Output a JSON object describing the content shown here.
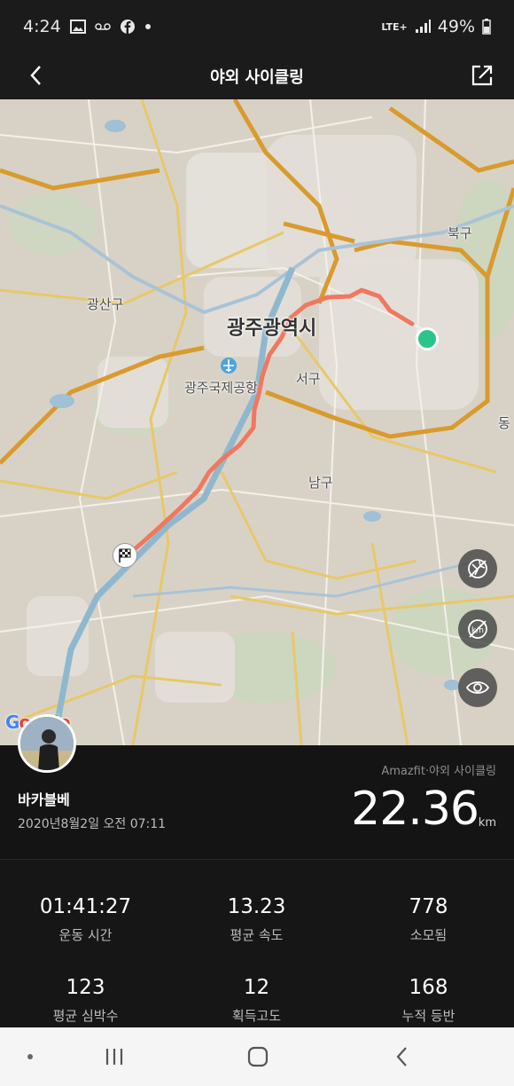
{
  "status_bar": {
    "time": "4:24",
    "network": "LTE+",
    "battery": "49%"
  },
  "header": {
    "title": "야외 사이클링",
    "back_icon": "chevron-left-icon",
    "share_icon": "share-icon"
  },
  "map": {
    "labels": {
      "city": "광주광역시",
      "gwangsan": "광산구",
      "airport": "광주국제공항",
      "seo": "서구",
      "nam": "남구",
      "buk": "북구",
      "dong": "동"
    },
    "controls": [
      "no-satellite-icon",
      "no-kmh-icon",
      "eye-icon"
    ],
    "route_color": "#f07860",
    "start_color": "#2bc48a",
    "attribution": "Google"
  },
  "summary": {
    "username": "바카블베",
    "datetime": "2020년8월2일 오전 07:11",
    "device": "Amazfit·야외 사이클링",
    "distance": "22.36",
    "unit": "km"
  },
  "stats": [
    {
      "value": "01:41:27",
      "label": "운동 시간"
    },
    {
      "value": "13.23",
      "label": "평균 속도"
    },
    {
      "value": "778",
      "label": "소모됨"
    },
    {
      "value": "123",
      "label": "평균 심박수"
    },
    {
      "value": "12",
      "label": "획득고도"
    },
    {
      "value": "168",
      "label": "누적 등반"
    }
  ],
  "nav": {
    "recent": "recent-apps-icon",
    "home": "home-icon",
    "back": "back-icon"
  }
}
